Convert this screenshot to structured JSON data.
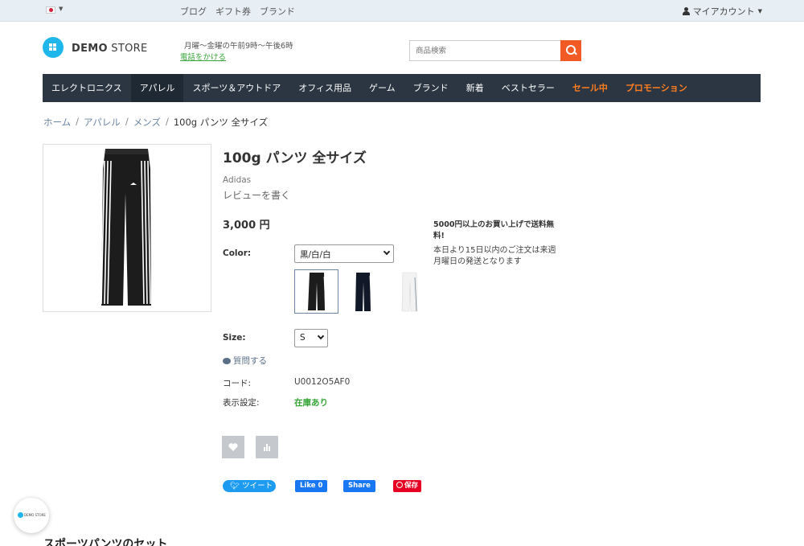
{
  "topbar": {
    "links": [
      "ブログ",
      "ギフト券",
      "ブランド"
    ],
    "account_label": "マイアカウント"
  },
  "header": {
    "logo_bold": "DEMO",
    "logo_rest": " STORE",
    "hours": "月曜〜金曜の午前9時〜午後6時",
    "phone_link": "電話をかける",
    "search_placeholder": "商品検索"
  },
  "nav": {
    "items": [
      "エレクトロニクス",
      "アパレル",
      "スポーツ＆アウトドア",
      "オフィス用品",
      "ゲーム",
      "ブランド",
      "新着",
      "ベストセラー",
      "セール中",
      "プロモーション"
    ]
  },
  "breadcrumb": {
    "items": [
      "ホーム",
      "アパレル",
      "メンズ"
    ],
    "current": "100g パンツ 全サイズ"
  },
  "product": {
    "title": "100g パンツ 全サイズ",
    "brand": "Adidas",
    "review_link": "レビューを書く",
    "price": "3,000 円",
    "shipping_bold": "5000円以上のお買い上げで送料無料!",
    "shipping_note": "本日より15日以内のご注文は来週月曜日の発送となります",
    "color_label": "Color:",
    "color_value": "黒/白/白",
    "size_label": "Size:",
    "size_value": "S",
    "ask_label": "質問する",
    "code_label": "コード:",
    "code_value": "U0012O5AF0",
    "availability_label": "表示設定:",
    "availability_value": "在庫あり"
  },
  "social": {
    "tweet": "ツイート",
    "fb_like": "Like 0",
    "fb_share": "Share",
    "pin": "保存"
  },
  "floating_badge": {
    "text": "DEMO STORE"
  },
  "section": {
    "title": "スポーツパンツのセット"
  },
  "colors": {
    "accent": "#f15a24",
    "nav_bg": "#2b3642",
    "logo": "#1fb6ec",
    "in_stock": "#3aa53a"
  }
}
